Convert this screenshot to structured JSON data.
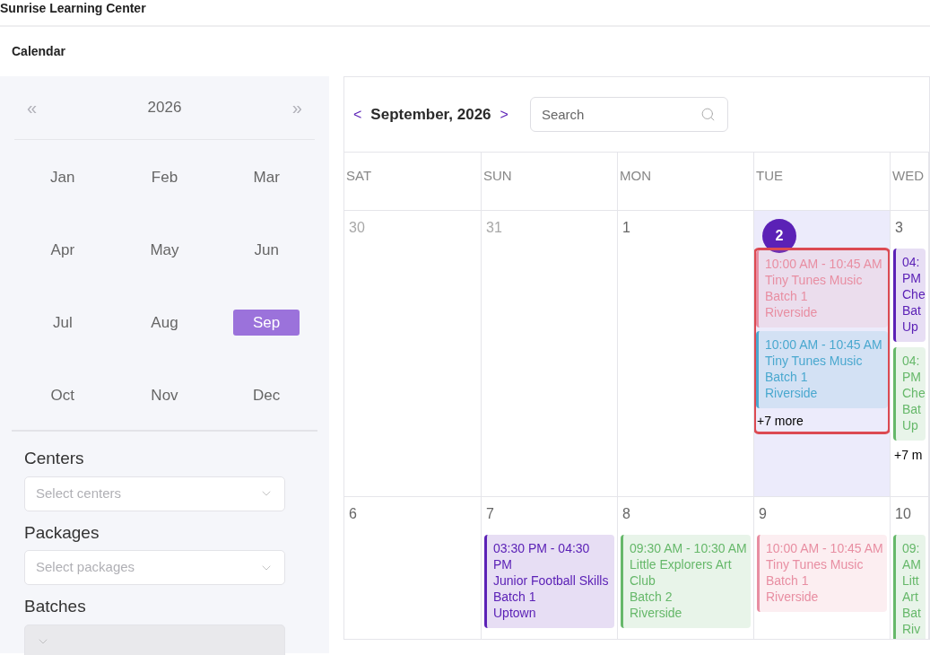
{
  "app_title": "Sunrise Learning Center",
  "page_title": "Calendar",
  "year_picker": {
    "prev": "«",
    "year": "2026",
    "next": "»"
  },
  "months": [
    {
      "label": "Jan",
      "selected": false
    },
    {
      "label": "Feb",
      "selected": false
    },
    {
      "label": "Mar",
      "selected": false
    },
    {
      "label": "Apr",
      "selected": false
    },
    {
      "label": "May",
      "selected": false
    },
    {
      "label": "Jun",
      "selected": false
    },
    {
      "label": "Jul",
      "selected": false
    },
    {
      "label": "Aug",
      "selected": false
    },
    {
      "label": "Sep",
      "selected": true
    },
    {
      "label": "Oct",
      "selected": false
    },
    {
      "label": "Nov",
      "selected": false
    },
    {
      "label": "Dec",
      "selected": false
    }
  ],
  "filters": [
    {
      "label": "Centers",
      "placeholder": "Select centers",
      "disabled": false
    },
    {
      "label": "Packages",
      "placeholder": "Select packages",
      "disabled": false
    },
    {
      "label": "Batches",
      "disabled": true
    }
  ],
  "calendar": {
    "prev": "<",
    "month": "September, 2026",
    "next": ">",
    "search": {
      "placeholder": "Search"
    },
    "weekdays": [
      "SAT",
      "SUN",
      "MON",
      "TUE",
      "WED"
    ],
    "weeks": [
      {
        "days": [
          {
            "number": "30",
            "muted": true,
            "selected": false,
            "highlighted": false
          },
          {
            "number": "31",
            "muted": true,
            "selected": false,
            "highlighted": false
          },
          {
            "number": "1",
            "muted": false,
            "selected": false,
            "highlighted": false
          },
          {
            "number": "2",
            "muted": false,
            "selected": true,
            "highlighted": true,
            "more": "+7 more",
            "events": [
              {
                "color": "#e88ea2",
                "lines": [
                  "10:00 AM - 10:45 AM",
                  "Tiny Tunes Music",
                  "Batch 1",
                  "Riverside"
                ]
              },
              {
                "color": "#4aa8cf",
                "lines": [
                  "10:00 AM - 10:45 AM",
                  "Tiny Tunes Music",
                  "Batch 1",
                  "Riverside"
                ]
              }
            ]
          },
          {
            "number": "3",
            "muted": false,
            "selected": false,
            "highlighted": false,
            "more": "+7 m",
            "events": [
              {
                "color": "#5b21b6",
                "lines": [
                  "04:",
                  "PM",
                  "Che",
                  "Bat",
                  "Up"
                ]
              },
              {
                "color": "#66b86a",
                "lines": [
                  "04:",
                  "PM",
                  "Che",
                  "Bat",
                  "Up"
                ]
              }
            ]
          }
        ]
      },
      {
        "days": [
          {
            "number": "6",
            "muted": false,
            "selected": false,
            "highlighted": false
          },
          {
            "number": "7",
            "muted": false,
            "selected": false,
            "highlighted": false,
            "events": [
              {
                "color": "#5b21b6",
                "lines": [
                  "03:30 PM - 04:30 PM",
                  "Junior Football Skills",
                  "Batch 1",
                  "Uptown"
                ]
              }
            ]
          },
          {
            "number": "8",
            "muted": false,
            "selected": false,
            "highlighted": false,
            "events": [
              {
                "color": "#66b86a",
                "lines": [
                  "09:30 AM - 10:30 AM",
                  "Little Explorers Art Club",
                  "Batch 2",
                  "Riverside"
                ]
              }
            ]
          },
          {
            "number": "9",
            "muted": false,
            "selected": false,
            "highlighted": false,
            "events": [
              {
                "color": "#e88ea2",
                "lines": [
                  "10:00 AM - 10:45 AM",
                  "Tiny Tunes Music",
                  "Batch 1",
                  "Riverside"
                ]
              }
            ]
          },
          {
            "number": "10",
            "muted": false,
            "selected": false,
            "highlighted": false,
            "events": [
              {
                "color": "#66b86a",
                "lines": [
                  "09:",
                  "AM",
                  "Litt",
                  "Art",
                  "Bat",
                  "Riv"
                ]
              }
            ]
          }
        ]
      }
    ]
  }
}
